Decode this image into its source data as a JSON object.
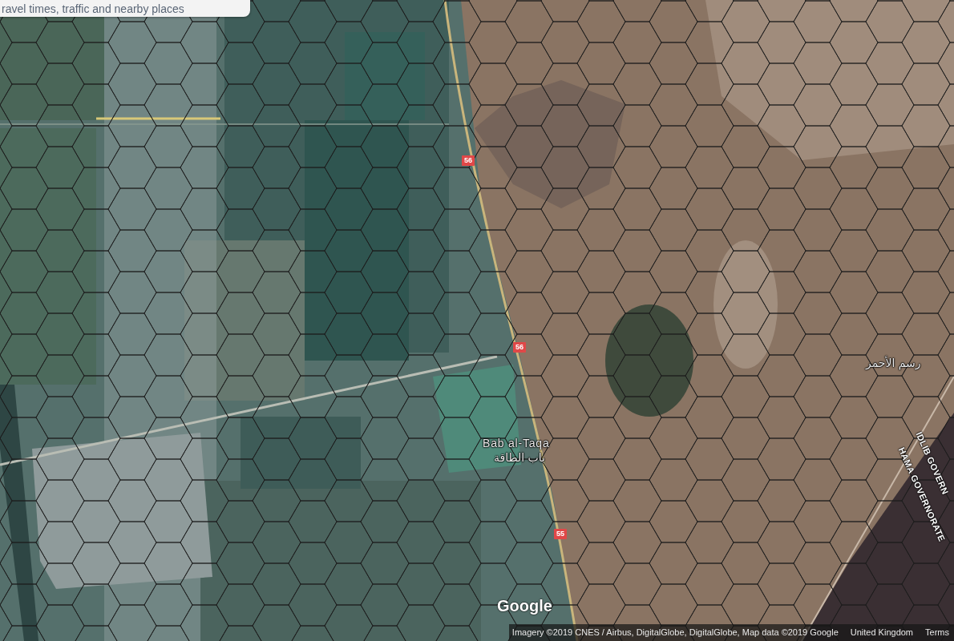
{
  "info_card": {
    "text": "ravel times, traffic and nearby places"
  },
  "map": {
    "route_shields": [
      "56",
      "56",
      "55"
    ],
    "place_labels": [
      "Bab al-Taqa",
      "باب الطاقة",
      "رسم الأحمر"
    ],
    "boundary_labels": [
      "IDLIB GOVERN",
      "HAMA GOVERNORATE"
    ]
  },
  "logo": {
    "text": "Google"
  },
  "attribution": {
    "items": [
      "Imagery ©2019 CNES / Airbus, DigitalGlobe, DigitalGlobe, Map data ©2019 Google",
      "United Kingdom",
      "Terms"
    ]
  }
}
